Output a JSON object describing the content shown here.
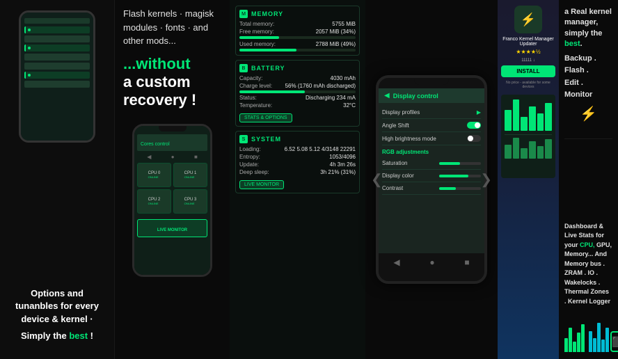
{
  "col1": {
    "options_text": "Options and tunanbles for every device & kernel ·",
    "simply_text": "Simply the ",
    "best_text": "best",
    "exclaim": " !"
  },
  "col2": {
    "top_text": "Flash kernels · magisk modules · fonts · and other mods...",
    "main_title_without": "...without",
    "main_title_rest": "a custom recovery !",
    "cores_label": "Cores control",
    "cpu0": "CPU 0",
    "cpu1": "CPU 1",
    "cpu2": "CPU 2",
    "cpu3": "CPU 3",
    "online": "ONLINE"
  },
  "col3": {
    "memory_title": "MEMORY",
    "total_label": "Total memory:",
    "total_value": "5755 MiB",
    "free_label": "Free memory:",
    "free_value": "2057 MiB (34%)",
    "used_label": "Used memory:",
    "used_value": "2788 MiB (49%)",
    "battery_title": "BATTERY",
    "capacity_label": "Capacity:",
    "capacity_value": "4030 mAh",
    "charge_label": "Charge level:",
    "charge_value": "56% (1760 mAh discharged)",
    "status_label": "Status:",
    "status_value": "Discharging 234 mA",
    "temp_label": "Temperature:",
    "temp_value": "32°C",
    "system_title": "SYSTEM",
    "loading_label": "Loading:",
    "loading_value": "6.52 5.08 5.12 4/3148 22291",
    "entropy_label": "Entropy:",
    "entropy_value": "1053/4096",
    "uptime_label": "Update:",
    "uptime_value": "4h 3m 26s",
    "deep_sleep_label": "Deep sleep:",
    "deep_sleep_value": "3h 21% (31%)",
    "stats_btn": "STATS & OPTIONS",
    "live_monitor_btn": "LIVE MONITOR"
  },
  "col4": {
    "header_title": "Display control",
    "back_icon": "◀",
    "display_profiles": "Display profiles",
    "angle_shift": "Angle Shift",
    "brightness": "High brightness mode",
    "rgb_adjustments": "RGB adjustments",
    "saturation": "Saturation",
    "display_color": "Display color",
    "contrast": "Contrast"
  },
  "col5": {
    "app_name": "Franco Kernel Manager Updater",
    "rating": "★★★★½",
    "rating_count": "11111 ↓",
    "install_btn": "INSTALL",
    "price": "No price - available for some devices"
  },
  "col6": {
    "section1_text": "a Real kernel manager, simply the best.",
    "section1_highlight": "best",
    "list_items": [
      "Backup .",
      "Flash .",
      "Edit .",
      "Monitor"
    ],
    "section2_title": "Dashboard & Live Stats for your CPU,",
    "section2_highlight": "CPU,",
    "section2_rest": "GPU, Memory... And Memory bus . ZRAM . IO . Wakelocks . Thermal Zones . Kernel Logger"
  }
}
